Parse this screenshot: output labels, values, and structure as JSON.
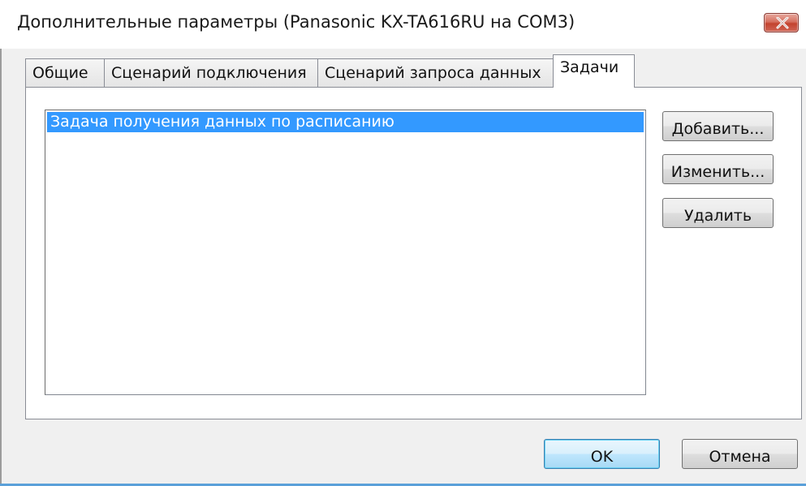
{
  "window": {
    "title": "Дополнительные параметры (Panasonic KX-TA616RU на COM3)"
  },
  "tabs": [
    {
      "label": "Общие",
      "active": false
    },
    {
      "label": "Сценарий подключения",
      "active": false
    },
    {
      "label": "Сценарий запроса данных",
      "active": false
    },
    {
      "label": "Задачи",
      "active": true
    }
  ],
  "tasks": {
    "items": [
      {
        "label": "Задача получения данных по расписанию",
        "selected": true
      }
    ],
    "buttons": {
      "add": "Добавить...",
      "edit": "Изменить...",
      "delete": "Удалить"
    }
  },
  "footer": {
    "ok": "OK",
    "cancel": "Отмена"
  },
  "colors": {
    "selection": "#3399ff",
    "close_button": "#c3432f",
    "default_button_border": "#3c7fb1"
  },
  "icons": {
    "close": "close-icon"
  }
}
